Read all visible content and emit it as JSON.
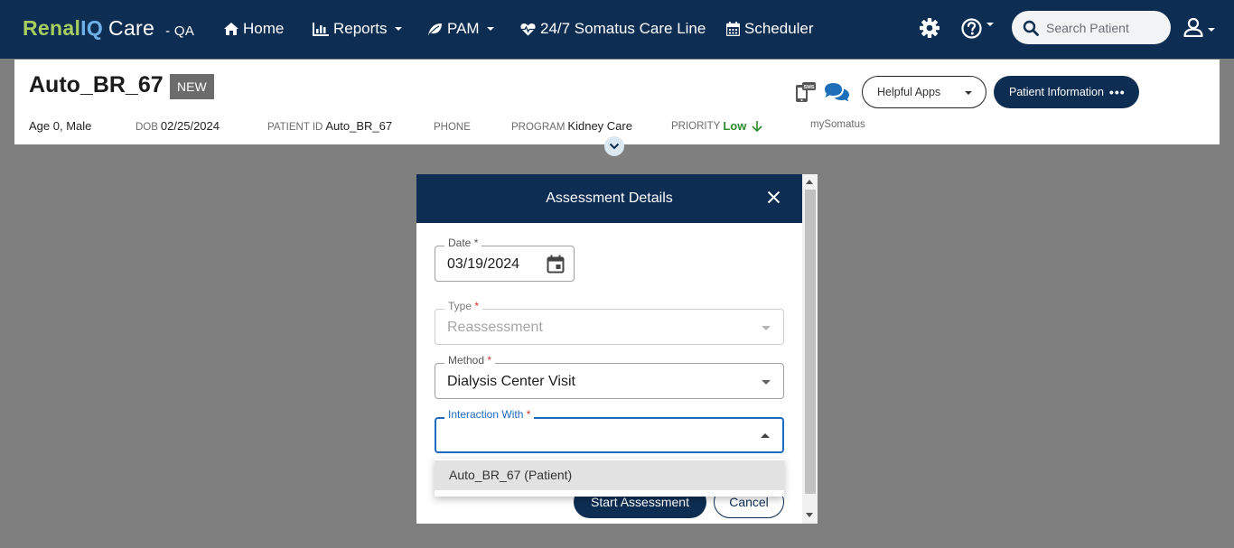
{
  "brand": {
    "name_part1": "Renal",
    "name_part2": "IQ",
    "name_part3": "Care",
    "env": "- QA"
  },
  "nav": {
    "home": "Home",
    "reports": "Reports",
    "pam": "PAM",
    "care_line": "24/7 Somatus Care Line",
    "scheduler": "Scheduler",
    "search_placeholder": "Search Patient"
  },
  "patient": {
    "name": "Auto_BR_67",
    "badge": "NEW",
    "age_sex": "Age 0, Male",
    "dob_label": "DOB",
    "dob": "02/25/2024",
    "patient_id_label": "PATIENT ID",
    "patient_id": "Auto_BR_67",
    "phone_label": "PHONE",
    "phone": "",
    "program_label": "PROGRAM",
    "program": "Kidney Care",
    "priority_label": "PRIORITY",
    "priority": "Low",
    "my_somatus": "mySomatus",
    "sms_icon_text": "SMS",
    "helpful_apps": "Helpful Apps",
    "patient_information": "Patient Information",
    "more_dots": "•••"
  },
  "modal": {
    "title": "Assessment Details",
    "date": {
      "label": "Date",
      "required": "*",
      "value": "03/19/2024"
    },
    "type": {
      "label": "Type",
      "required": "*",
      "value": "Reassessment"
    },
    "method": {
      "label": "Method",
      "required": "*",
      "value": "Dialysis Center Visit"
    },
    "interaction": {
      "label": "Interaction With",
      "required": "*",
      "value": ""
    },
    "dropdown_options": [
      "Auto_BR_67 (Patient)"
    ],
    "start_button": "Start Assessment",
    "cancel_button": "Cancel"
  },
  "colors": {
    "navy": "#0d2d52",
    "brand_green": "#a6cf5f",
    "brand_blue": "#6fb0e8",
    "priority_low": "#2e8b2e",
    "focus_blue": "#1e6ac0",
    "overlay": "#7f7f7f"
  },
  "icons": [
    "home-icon",
    "chart-bar-icon",
    "leaf-icon",
    "heartbeat-icon",
    "calendar-icon",
    "gear-icon",
    "help-circle-icon",
    "search-icon",
    "user-icon",
    "sms-phone-icon",
    "chat-bubbles-icon",
    "arrow-down-icon",
    "chevron-down-icon",
    "close-icon",
    "calendar-picker-icon"
  ]
}
